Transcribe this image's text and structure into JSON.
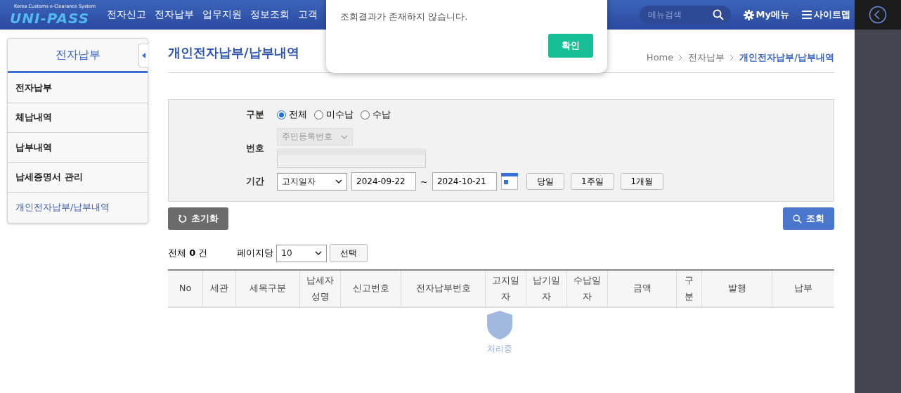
{
  "header": {
    "logo_tagline": "Korea Customs e-Clearance System",
    "logo": "UNI-PASS",
    "nav": [
      "전자신고",
      "전자납부",
      "업무지원",
      "정보조회",
      "고객"
    ],
    "search": {
      "placeholder": "메뉴검색"
    },
    "links": [
      {
        "kind": "gear",
        "label": "My메뉴"
      },
      {
        "kind": "menu",
        "label": "사이트맵"
      }
    ]
  },
  "sidebar": {
    "title": "전자납부",
    "items": [
      {
        "label": "전자납부",
        "selected": false
      },
      {
        "label": "체납내역",
        "selected": false
      },
      {
        "label": "납부내역",
        "selected": false
      },
      {
        "label": "납세증명서 관리",
        "selected": false
      },
      {
        "label": "개인전자납부/납부내역",
        "selected": true
      }
    ]
  },
  "page": {
    "title": "개인전자납부/납부내역",
    "breadcrumb": [
      "Home",
      "전자납부",
      "개인전자납부/납부내역"
    ]
  },
  "form": {
    "type_label": "구분",
    "types": [
      {
        "label": "전체",
        "selected": true
      },
      {
        "label": "미수납",
        "selected": false
      },
      {
        "label": "수납",
        "selected": false
      }
    ],
    "number_label": "번호",
    "number_select": {
      "value": "주민등록번호",
      "disabled": true
    },
    "period_label": "기간",
    "period_select": "고지일자",
    "date_from": "2024-09-22",
    "separator": "~",
    "date_to": "2024-10-21",
    "quick": [
      "당일",
      "1주일",
      "1개월"
    ]
  },
  "reset_button": "초기화",
  "search_button": "조회",
  "summary": {
    "prefix": "전체",
    "count": "0",
    "suffix": "건",
    "per_page_label": "페이지당",
    "per_page": "10",
    "apply": "선택"
  },
  "table": {
    "columns": [
      "No",
      "세관",
      "세목구분",
      "납세자성명",
      "신고번호",
      "전자납부번호",
      "고지일자",
      "납기일자",
      "수납일자",
      "금액",
      "구분",
      "발행",
      "납부"
    ]
  },
  "loading": {
    "label": "처리중"
  },
  "dialog": {
    "message": "조회결과가 존재하지 않습니다.",
    "ok": "확인"
  }
}
